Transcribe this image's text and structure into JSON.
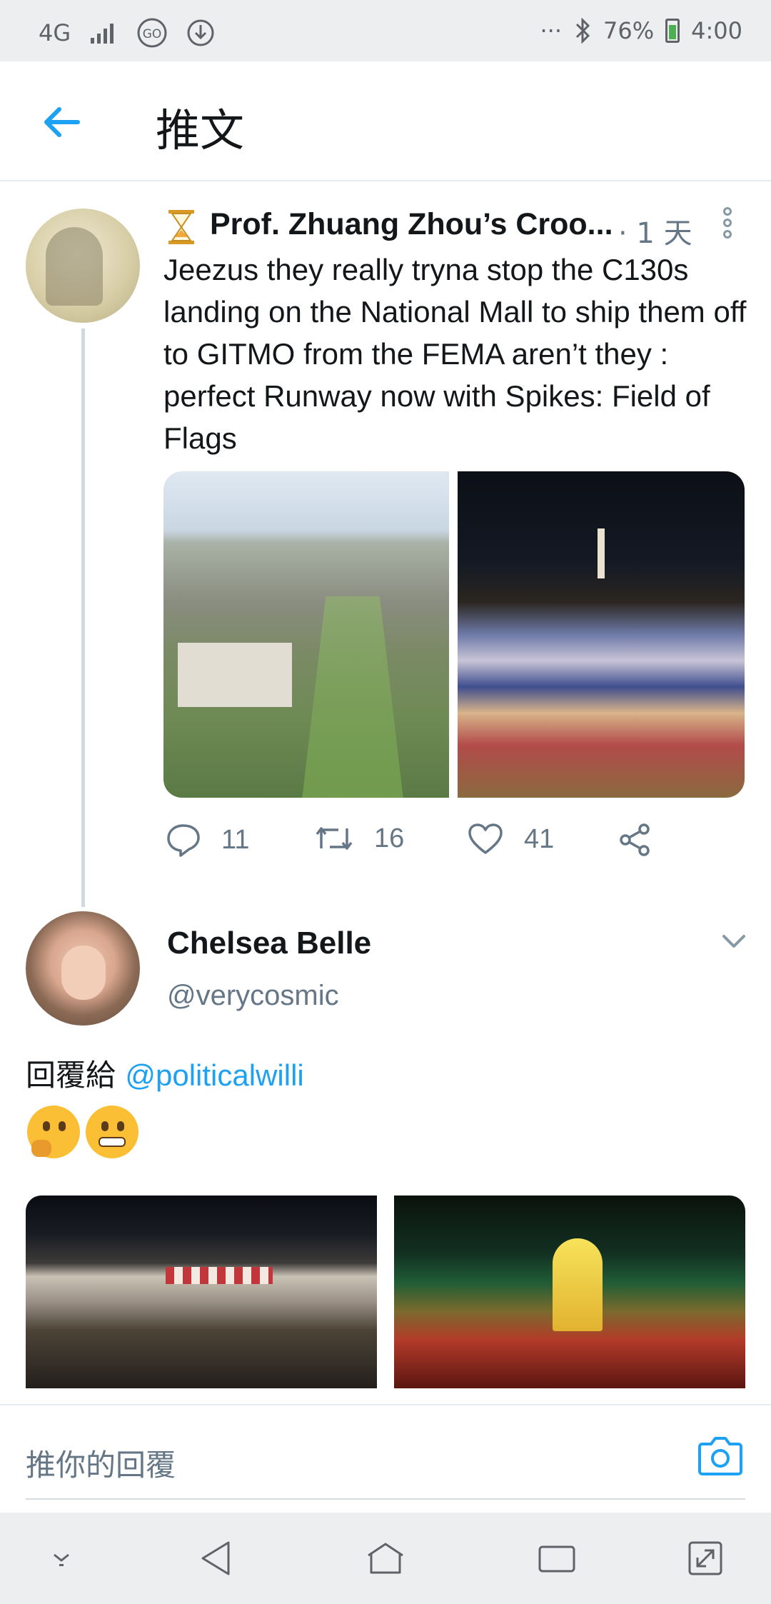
{
  "status_bar": {
    "network": "4G",
    "battery_percent": "76%",
    "time": "4:00",
    "colors": {
      "battery_fill": "#4caf50"
    }
  },
  "header": {
    "title": "推文"
  },
  "tweet1": {
    "author_name": "Prof. Zhuang Zhou’s Croo...",
    "time": "· 1 天",
    "text": "Jeezus they really tryna stop the C130s landing on the National Mall to ship them off to GITMO from the FEMA aren’t they : perfect Runway now with Spikes: Field of Flags",
    "replies": "11",
    "retweets": "16",
    "likes": "41"
  },
  "tweet2": {
    "author_name": "Chelsea Belle",
    "handle": "@verycosmic",
    "reply_prefix": "回覆給",
    "reply_mention": "@politicalwilli",
    "emojis": [
      "thinking-face",
      "grimacing-face"
    ]
  },
  "composer": {
    "placeholder": "推你的回覆"
  },
  "colors": {
    "accent": "#1da1f2",
    "secondary_text": "#657786"
  }
}
